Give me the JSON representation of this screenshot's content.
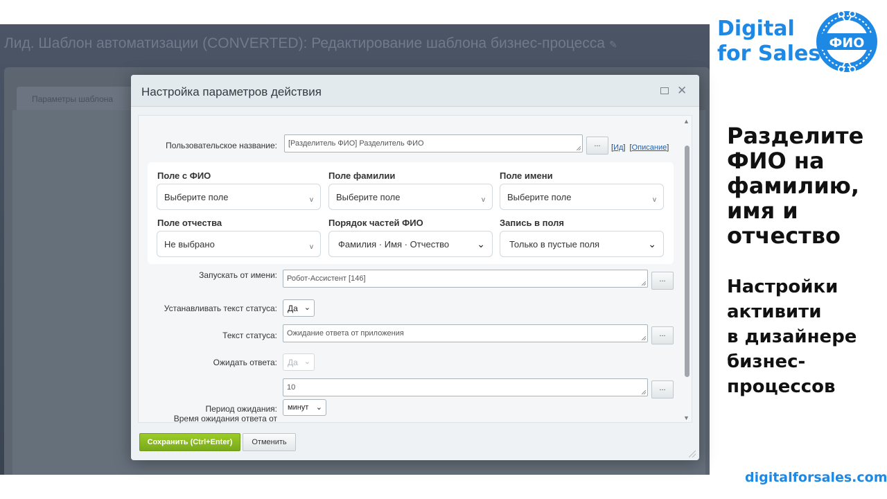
{
  "app": {
    "title": "Лид. Шаблон автоматизации (CONVERTED): Редактирование шаблона бизнес-процесса",
    "tab_label": "Параметры шаблона"
  },
  "dialog": {
    "title": "Настройка параметров действия",
    "fields": {
      "custom_name": {
        "label": "Пользовательское название:",
        "value": "[Разделитель ФИО] Разделитель ФИО"
      },
      "id_link": "Ид",
      "description_link": "Описание",
      "run_as": {
        "label": "Запускать от имени:",
        "value": "Робот-Ассистент [146]"
      },
      "set_status": {
        "label": "Устанавливать текст статуса:",
        "value": "Да"
      },
      "status_text": {
        "label": "Текст статуса:",
        "value": "Ожидание ответа от приложения"
      },
      "wait_response": {
        "label": "Ожидать ответа:",
        "value": "Да"
      },
      "wait_value": {
        "value": "10"
      },
      "wait_period": {
        "label": "Период ожидания:",
        "value": "минут"
      },
      "wait_time_label": "Время ожидания ответа от"
    },
    "dots_label": "...",
    "card": {
      "fio_field": {
        "label": "Поле с ФИО",
        "value": "Выберите поле"
      },
      "surname_field": {
        "label": "Поле фамилии",
        "value": "Выберите поле"
      },
      "name_field": {
        "label": "Поле имени",
        "value": "Выберите поле"
      },
      "patronymic_field": {
        "label": "Поле отчества",
        "value": "Не выбрано"
      },
      "order": {
        "label": "Порядок частей ФИО",
        "value": "Фамилия · Имя · Отчество"
      },
      "write_mode": {
        "label": "Запись в поля",
        "value": "Только в пустые поля"
      }
    },
    "buttons": {
      "save": "Сохранить (Ctrl+Enter)",
      "cancel": "Отменить"
    }
  },
  "branding": {
    "line1": "Digital",
    "line2": "for Sales",
    "logo_text": "ФИО",
    "site": "digitalforsales.com",
    "accent_color": "#1e88e5"
  },
  "slide": {
    "heading": [
      "Разделите",
      "ФИО на",
      "фамилию,",
      "имя и",
      "отчество"
    ],
    "subheading": [
      "Настройки",
      "активити",
      "в дизайнере",
      "бизнес-",
      "процессов"
    ]
  }
}
